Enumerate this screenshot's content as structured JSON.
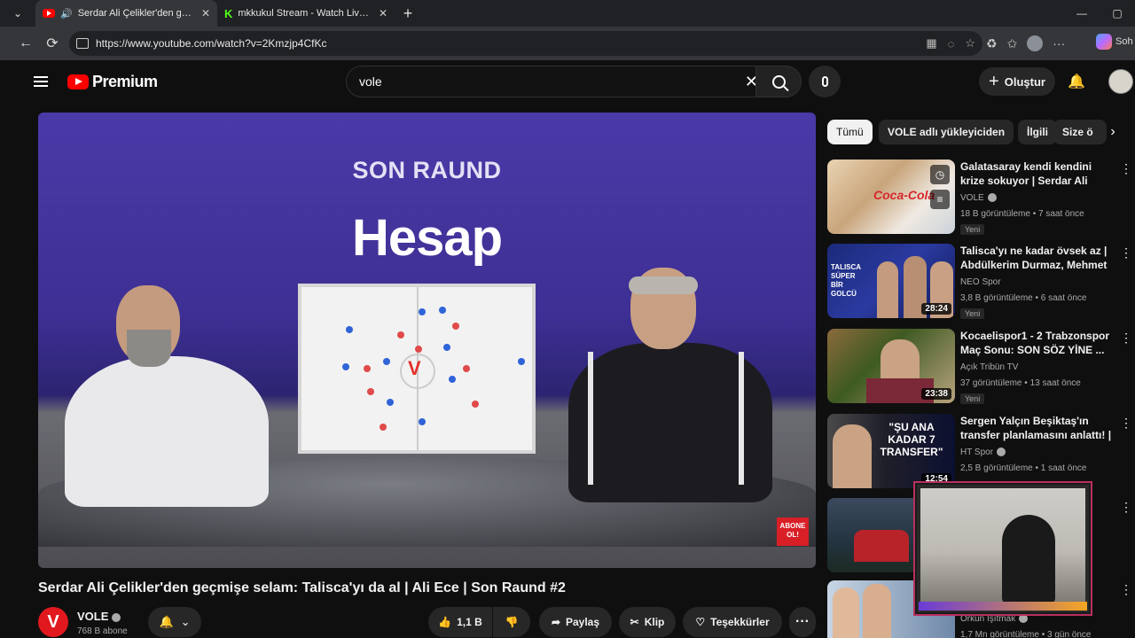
{
  "browser": {
    "tabs": [
      {
        "title": "Serdar Ali Çelikler'den geçmişe",
        "active": true
      },
      {
        "title": "mkkukul Stream - Watch Live on K",
        "active": false
      }
    ],
    "url": "https://www.youtube.com/watch?v=2Kmzjp4CfKc",
    "copilot_label": "Soh"
  },
  "header": {
    "logo_text": "Premium",
    "search_value": "vole",
    "create_label": "Oluştur"
  },
  "player": {
    "show_title": "SON RAUND",
    "logo_word": "Hesap",
    "abone_text": "ABONE OL!"
  },
  "video": {
    "title": "Serdar Ali Çelikler'den geçmişe selam: Talisca'yı da al | Ali Ece | Son Raund #2",
    "channel_initial": "V",
    "channel_name": "VOLE",
    "subscribers": "768 B abone",
    "likes": "1,1 B",
    "share_label": "Paylaş",
    "clip_label": "Klip",
    "thanks_label": "Teşekkürler"
  },
  "chips": [
    "Tümü",
    "VOLE adlı yükleyiciden",
    "İlgili",
    "Size ö"
  ],
  "recommendations": [
    {
      "title": "Galatasaray kendi kendini krize sokuyor | Serdar Ali Çelikler, Al...",
      "channel": "VOLE",
      "meta": "18 B görüntüleme • 7 saat önce",
      "badge": "Yeni",
      "duration": "",
      "thumb_text": "Coca-Cola"
    },
    {
      "title": "Talisca'yı ne kadar övsek az | Abdülkerim Durmaz, Mehmet ...",
      "channel": "NEO Spor",
      "meta": "3,8 B görüntüleme • 6 saat önce",
      "badge": "Yeni",
      "duration": "28:24",
      "thumb_text": "TALISCA SÜPER BİR GOLCÜ"
    },
    {
      "title": "Kocaelispor1 - 2 Trabzonspor Maç Sonu: SON SÖZ YİNE ...",
      "channel": "Açık Tribün TV",
      "meta": "37 görüntüleme • 13 saat önce",
      "badge": "Yeni",
      "duration": "23:38",
      "thumb_text": ""
    },
    {
      "title": "Sergen Yalçın Beşiktaş'ın transfer planlamasını anlattı! | ...",
      "channel": "HT Spor",
      "meta": "2,5 B görüntüleme • 1 saat önce",
      "badge": "",
      "duration": "12:54",
      "thumb_text": "\"ŞU ANA KADAR 7 TRANSFER\""
    },
    {
      "title": "",
      "channel": "",
      "meta": "",
      "badge": "",
      "duration": "",
      "thumb_text": ""
    },
    {
      "title": "",
      "channel": "Orkun Işıtmak",
      "meta": "1,7 Mn görüntüleme • 3 gün önce",
      "badge": "",
      "duration": "",
      "thumb_text": ""
    }
  ]
}
